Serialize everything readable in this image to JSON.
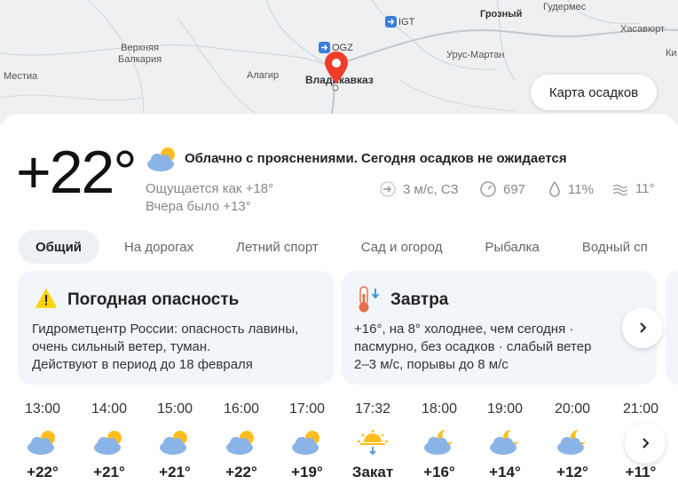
{
  "map": {
    "labels": {
      "grozny": "Грозный",
      "gudermes": "Гудермес",
      "khasavyurt": "Хасавюрт",
      "ki": "Ки",
      "urus_martan": "Урус-Мартан",
      "verkhnyaya_balkaria": "Верхняя\nБалкария",
      "mestia": "Местиа",
      "alagir": "Алагир",
      "vladikavkaz": "Владикавказ"
    },
    "airports": {
      "igt": "IGT",
      "ogz": "OGZ"
    },
    "precip_button": "Карта осадков"
  },
  "current": {
    "temperature": "+22°",
    "condition": "Облачно с прояснениями. Сегодня осадков не ожидается",
    "feels_like": "Ощущается как +18°",
    "yesterday": "Вчера было +13°",
    "wind": "3 м/с, СЗ",
    "pressure": "697",
    "humidity": "11%",
    "water": "11°"
  },
  "tabs": [
    "Общий",
    "На дорогах",
    "Летний спорт",
    "Сад и огород",
    "Рыбалка",
    "Водный сп"
  ],
  "warning": {
    "title": "Погодная опасность",
    "line1": "Гидрометцентр России: опасность лавины,",
    "line2": "очень сильный ветер, туман.",
    "line3": "Действуют в период до 18 февраля"
  },
  "tomorrow": {
    "title": "Завтра",
    "line1": "+16°, на 8° холоднее, чем сегодня ·",
    "line2": "пасмурно, без осадков · слабый ветер",
    "line3": "2–3 м/с, порывы до 8 м/с"
  },
  "hourly": [
    {
      "time": "13:00",
      "value": "+22°",
      "icon": "partly-cloudy-day-icon"
    },
    {
      "time": "14:00",
      "value": "+21°",
      "icon": "partly-cloudy-day-icon"
    },
    {
      "time": "15:00",
      "value": "+21°",
      "icon": "partly-cloudy-day-icon"
    },
    {
      "time": "16:00",
      "value": "+22°",
      "icon": "partly-cloudy-day-icon"
    },
    {
      "time": "17:00",
      "value": "+19°",
      "icon": "partly-cloudy-day-icon"
    },
    {
      "time": "17:32",
      "value": "Закат",
      "icon": "sunset-icon"
    },
    {
      "time": "18:00",
      "value": "+16°",
      "icon": "partly-cloudy-night-icon"
    },
    {
      "time": "19:00",
      "value": "+14°",
      "icon": "partly-cloudy-night-icon"
    },
    {
      "time": "20:00",
      "value": "+12°",
      "icon": "partly-cloudy-night-icon"
    },
    {
      "time": "21:00",
      "value": "+11°",
      "icon": "partly-cloudy-night-icon"
    }
  ],
  "colors": {
    "accent_pin": "#f03c28",
    "sun": "#ffbe1e",
    "cloud": "#8ab4e8",
    "card_bg": "#f2f6fa",
    "warning": "#ffd400"
  }
}
